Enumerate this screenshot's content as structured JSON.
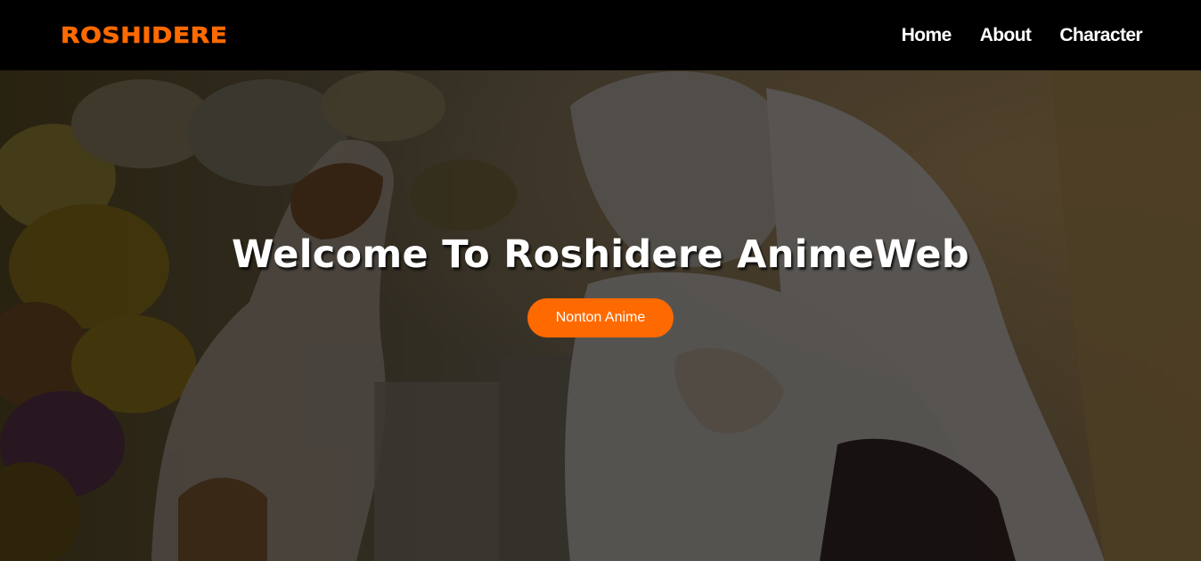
{
  "header": {
    "logo": "ROSHIDERE",
    "nav": [
      {
        "label": "Home"
      },
      {
        "label": "About"
      },
      {
        "label": "Character"
      }
    ]
  },
  "hero": {
    "title": "Welcome To Roshidere AnimeWeb",
    "button_label": "Nonton Anime"
  },
  "colors": {
    "accent": "#ff6a00",
    "nav_bg": "#000000",
    "text": "#ffffff"
  }
}
